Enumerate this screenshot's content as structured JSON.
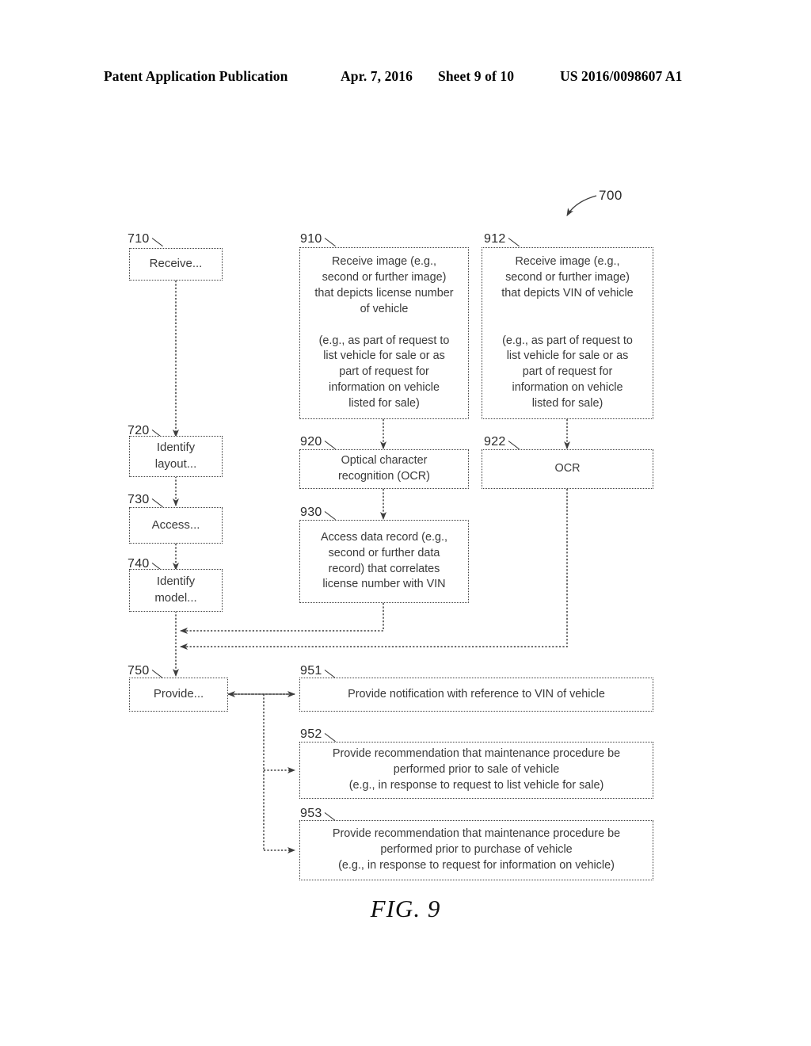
{
  "header": {
    "publication": "Patent Application Publication",
    "date": "Apr. 7, 2016",
    "sheet": "Sheet 9 of 10",
    "number": "US 2016/0098607 A1"
  },
  "figure": {
    "caption": "FIG. 9",
    "diagram_ref": "700",
    "nodes": [
      {
        "ref": "710",
        "text": "Receive..."
      },
      {
        "ref": "720",
        "text": "Identify\nlayout..."
      },
      {
        "ref": "730",
        "text": "Access..."
      },
      {
        "ref": "740",
        "text": "Identify\nmodel..."
      },
      {
        "ref": "750",
        "text": "Provide..."
      },
      {
        "ref": "910",
        "text": "Receive image (e.g.,\nsecond or further image)\nthat depicts license number\nof vehicle\n\n(e.g., as part of request to\nlist vehicle for sale or as\npart of request for\ninformation on vehicle\nlisted for sale)"
      },
      {
        "ref": "912",
        "text": "Receive image (e.g.,\nsecond or further image)\nthat depicts VIN of vehicle\n\n\n(e.g., as part of request to\nlist vehicle for sale or as\npart of request for\ninformation on vehicle\nlisted for sale)"
      },
      {
        "ref": "920",
        "text": "Optical character\nrecognition (OCR)"
      },
      {
        "ref": "922",
        "text": "OCR"
      },
      {
        "ref": "930",
        "text": "Access data record (e.g.,\nsecond or further data\nrecord) that correlates\nlicense number with VIN"
      },
      {
        "ref": "951",
        "text": "Provide notification with reference to VIN of vehicle"
      },
      {
        "ref": "952",
        "text": "Provide recommendation that maintenance procedure be\nperformed prior to sale of vehicle\n(e.g., in response to request to list vehicle for sale)"
      },
      {
        "ref": "953",
        "text": "Provide recommendation that maintenance procedure be\nperformed prior to purchase of vehicle\n(e.g., in response to request for information on vehicle)"
      }
    ]
  },
  "colors": {
    "ink": "#000000",
    "line": "#3d3d3d",
    "text": "#3a3a3a"
  }
}
